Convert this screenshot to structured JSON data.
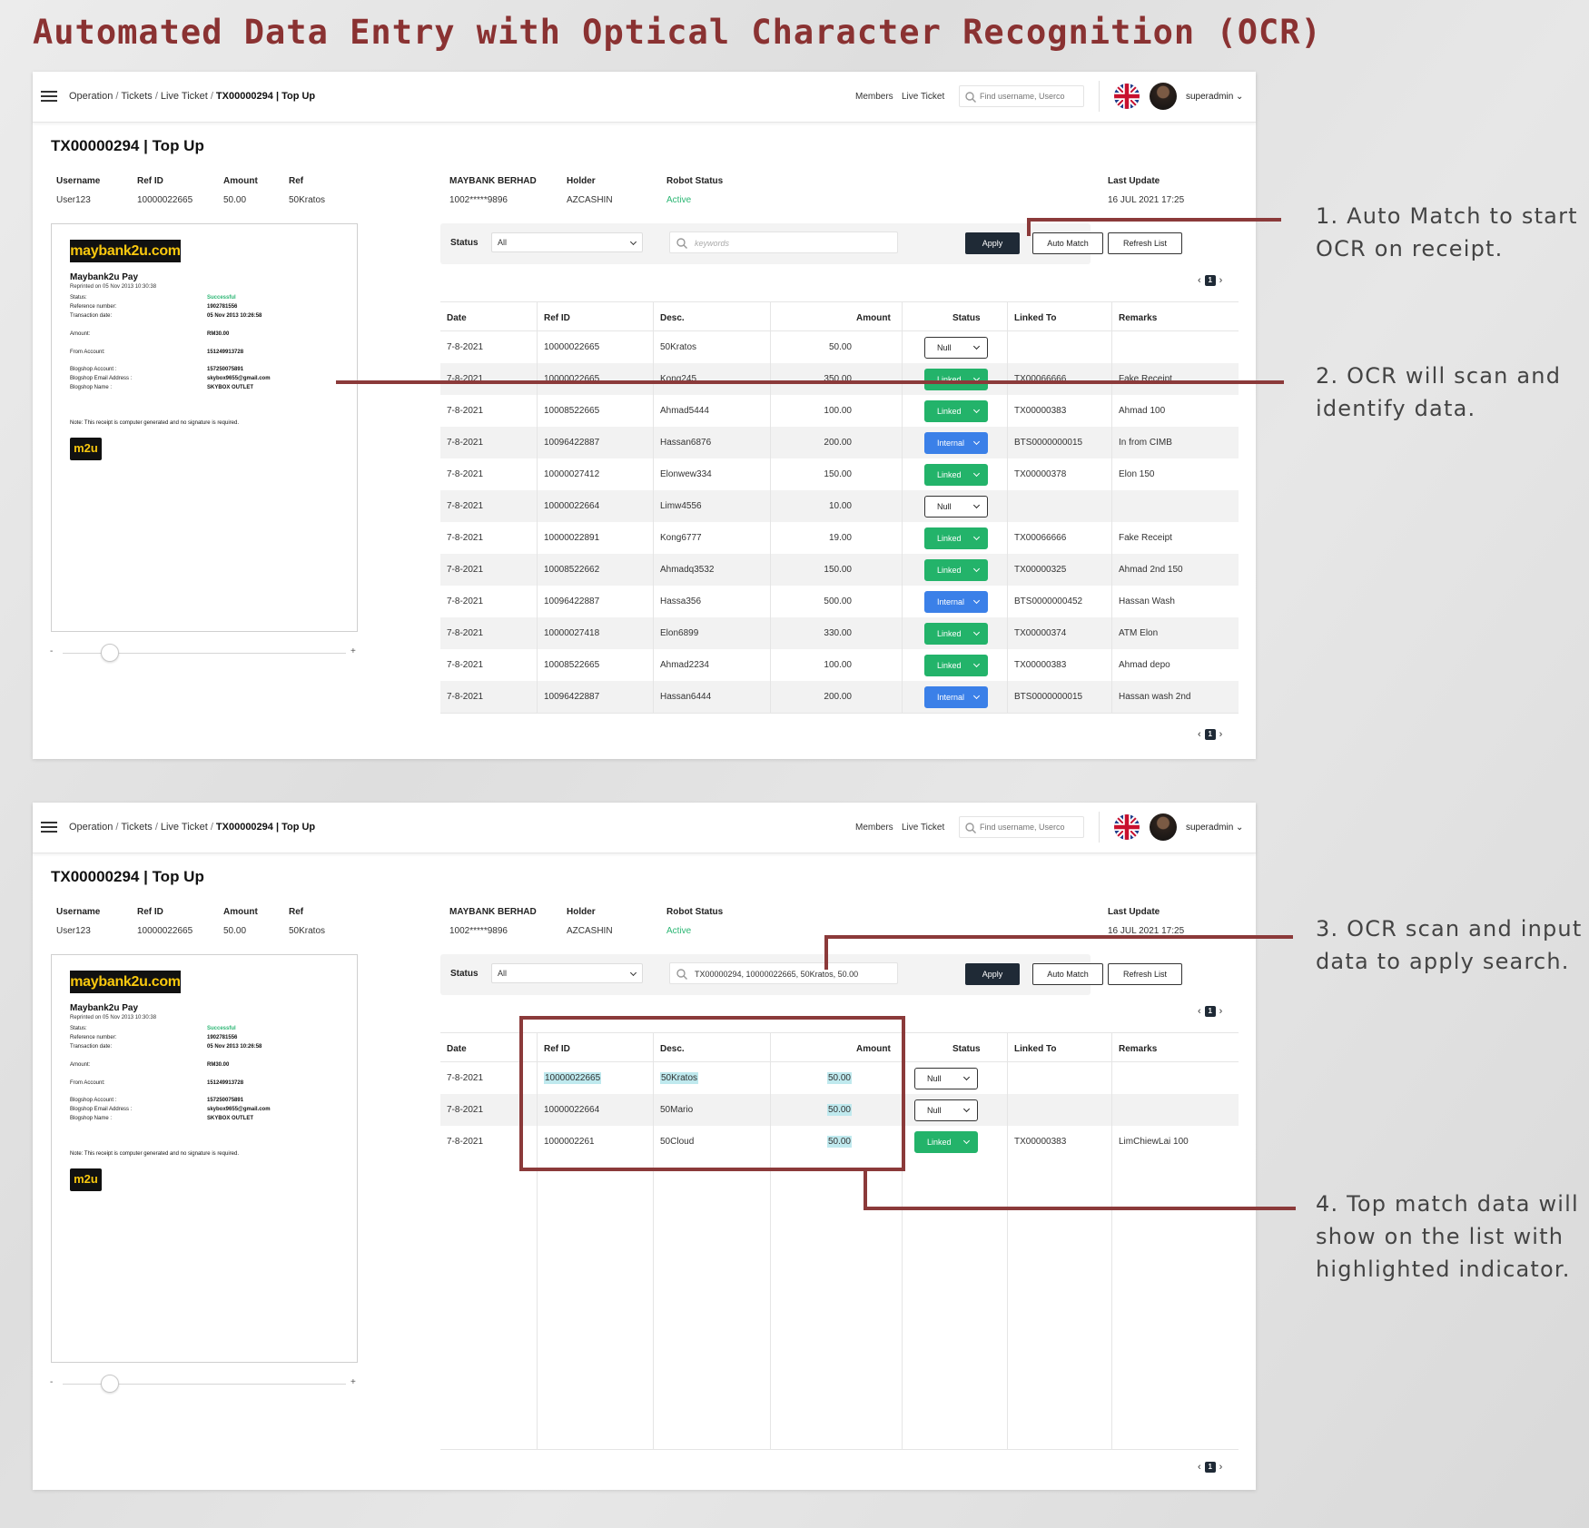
{
  "page_title": "Automated Data Entry with Optical Character Recognition (OCR)",
  "annotations": [
    "1. Auto Match to start\nOCR on receipt.",
    "2. OCR will scan and\nidentify data.",
    "3. OCR scan and input\ndata to apply search.",
    "4. Top match data will\nshow on the list with\nhighlighted indicator."
  ],
  "header": {
    "breadcrumb": [
      "Operation",
      "Tickets",
      "Live Ticket",
      "TX00000294 | Top Up"
    ],
    "nav_members": "Members",
    "nav_live_ticket": "Live Ticket",
    "search_placeholder": "Find username, Userco",
    "username": "superadmin"
  },
  "ticket": {
    "title": "TX00000294 | Top Up",
    "labels": {
      "username": "Username",
      "ref_id": "Ref ID",
      "amount": "Amount",
      "ref": "Ref",
      "bank": "MAYBANK BERHAD",
      "holder": "Holder",
      "robot_status": "Robot Status",
      "last_update": "Last Update"
    },
    "values": {
      "username": "User123",
      "ref_id": "10000022665",
      "amount": "50.00",
      "ref": "50Kratos",
      "bank": "1002*****9896",
      "holder": "AZCASHIN",
      "robot_status": "Active",
      "last_update": "16 JUL 2021 17:25"
    }
  },
  "receipt": {
    "logo": "maybank2u.com",
    "heading": "Maybank2u Pay",
    "reprinted": "Reprinted on 05 Nov 2013 10:30:38",
    "fields": [
      {
        "k": "Status:",
        "v": "Successful"
      },
      {
        "k": "Reference number:",
        "v": "1902781556"
      },
      {
        "k": "Transaction date:",
        "v": "05 Nov 2013 10:26:58"
      },
      {
        "k": "Amount:",
        "v": "RM30.00"
      },
      {
        "k": "From Account:",
        "v": "151249913728"
      },
      {
        "k": "Blogshop Account :",
        "v": "157250075891"
      },
      {
        "k": "Blogshop Email Address :",
        "v": "skybox9655@gmail.com"
      },
      {
        "k": "Blogshop Name :",
        "v": "SKYBOX OUTLET"
      }
    ],
    "note": "Note: This receipt is computer generated and no signature is required.",
    "badge": "m2u",
    "zoom_minus": "-",
    "zoom_plus": "+"
  },
  "filter": {
    "status_label": "Status",
    "status_value": "All",
    "keyword_placeholder": "keywords",
    "ocr_search_value": "TX00000294, 10000022665, 50Kratos, 50.00",
    "apply": "Apply",
    "auto_match": "Auto Match",
    "refresh": "Refresh List"
  },
  "pagination": {
    "prev": "‹",
    "page": "1",
    "next": "›"
  },
  "table": {
    "headers": [
      "Date",
      "Ref ID",
      "Desc.",
      "Amount",
      "Status",
      "Linked To",
      "Remarks"
    ],
    "rows_before": [
      {
        "date": "7-8-2021",
        "ref": "10000022665",
        "desc": "50Kratos",
        "amount": "50.00",
        "status": "Null",
        "linked": "",
        "remarks": ""
      },
      {
        "date": "7-8-2021",
        "ref": "10000022665",
        "desc": "Kong245",
        "amount": "350.00",
        "status": "Linked",
        "linked": "TX00066666",
        "remarks": "Fake Receipt"
      },
      {
        "date": "7-8-2021",
        "ref": "10008522665",
        "desc": "Ahmad5444",
        "amount": "100.00",
        "status": "Linked",
        "linked": "TX00000383",
        "remarks": "Ahmad 100"
      },
      {
        "date": "7-8-2021",
        "ref": "10096422887",
        "desc": "Hassan6876",
        "amount": "200.00",
        "status": "Internal",
        "linked": "BTS0000000015",
        "remarks": "In from CIMB"
      },
      {
        "date": "7-8-2021",
        "ref": "10000027412",
        "desc": "Elonwew334",
        "amount": "150.00",
        "status": "Linked",
        "linked": "TX00000378",
        "remarks": "Elon 150"
      },
      {
        "date": "7-8-2021",
        "ref": "10000022664",
        "desc": "Limw4556",
        "amount": "10.00",
        "status": "Null",
        "linked": "",
        "remarks": ""
      },
      {
        "date": "7-8-2021",
        "ref": "10000022891",
        "desc": "Kong6777",
        "amount": "19.00",
        "status": "Linked",
        "linked": "TX00066666",
        "remarks": "Fake Receipt"
      },
      {
        "date": "7-8-2021",
        "ref": "10008522662",
        "desc": "Ahmadq3532",
        "amount": "150.00",
        "status": "Linked",
        "linked": "TX00000325",
        "remarks": "Ahmad 2nd 150"
      },
      {
        "date": "7-8-2021",
        "ref": "10096422887",
        "desc": "Hassa356",
        "amount": "500.00",
        "status": "Internal",
        "linked": "BTS0000000452",
        "remarks": "Hassan Wash"
      },
      {
        "date": "7-8-2021",
        "ref": "10000027418",
        "desc": "Elon6899",
        "amount": "330.00",
        "status": "Linked",
        "linked": "TX00000374",
        "remarks": "ATM Elon"
      },
      {
        "date": "7-8-2021",
        "ref": "10008522665",
        "desc": "Ahmad2234",
        "amount": "100.00",
        "status": "Linked",
        "linked": "TX00000383",
        "remarks": "Ahmad depo"
      },
      {
        "date": "7-8-2021",
        "ref": "10096422887",
        "desc": "Hassan6444",
        "amount": "200.00",
        "status": "Internal",
        "linked": "BTS0000000015",
        "remarks": "Hassan wash 2nd"
      }
    ],
    "rows_after": [
      {
        "date": "7-8-2021",
        "ref": "10000022665",
        "desc": "50Kratos",
        "amount": "50.00",
        "status": "Null",
        "linked": "",
        "remarks": "",
        "hl_ref": true,
        "hl_desc": true,
        "hl_amount": true
      },
      {
        "date": "7-8-2021",
        "ref": "10000022664",
        "desc": "50Mario",
        "amount": "50.00",
        "status": "Null",
        "linked": "",
        "remarks": "",
        "hl_ref": false,
        "hl_desc": false,
        "hl_amount": true
      },
      {
        "date": "7-8-2021",
        "ref": "1000002261",
        "desc": "50Cloud",
        "amount": "50.00",
        "status": "Linked",
        "linked": "TX00000383",
        "remarks": "LimChiewLai 100",
        "hl_ref": false,
        "hl_desc": false,
        "hl_amount": true
      }
    ]
  },
  "colors": {
    "title": "#8a3232",
    "callout": "#8b3a3a",
    "linked": "#23b36a",
    "internal": "#3b80e8",
    "active": "#2bb673",
    "highlight": "#bfe9ee"
  }
}
